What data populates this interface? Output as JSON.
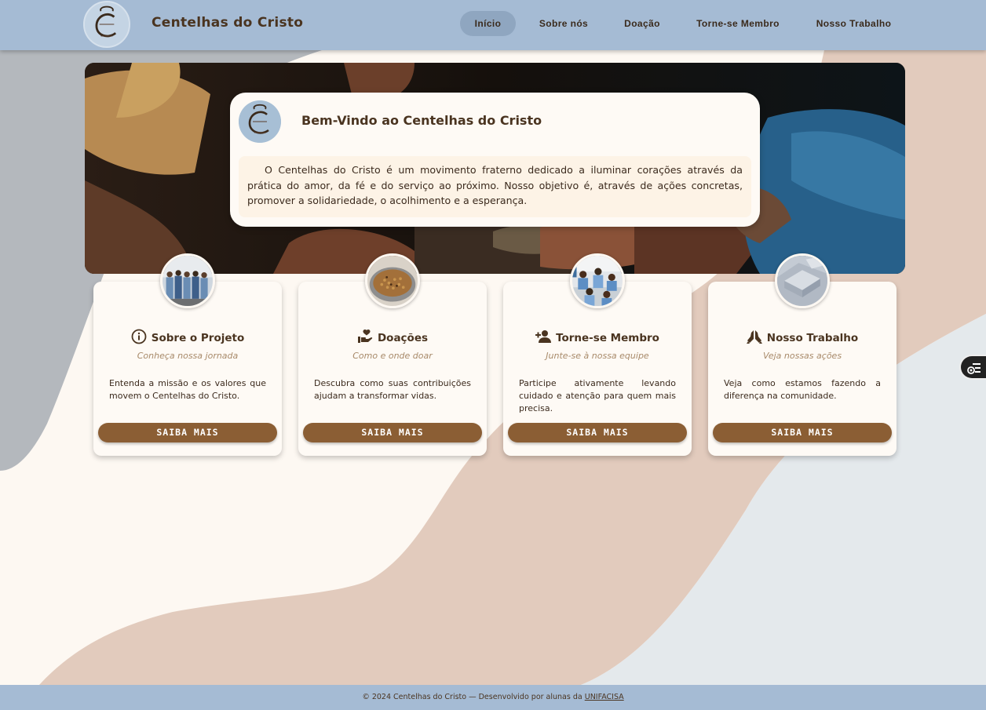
{
  "header": {
    "brand": "Centelhas do Cristo",
    "nav": [
      {
        "label": "Início",
        "active": true
      },
      {
        "label": "Sobre nós",
        "active": false
      },
      {
        "label": "Doação",
        "active": false
      },
      {
        "label": "Torne-se Membro",
        "active": false
      },
      {
        "label": "Nosso Trabalho",
        "active": false
      }
    ]
  },
  "welcome": {
    "title": "Bem-Vindo ao Centelhas do Cristo",
    "text": "O Centelhas do Cristo é um movimento fraterno dedicado a iluminar corações através da prática do amor, da fé e do serviço ao próximo. Nosso objetivo é, através de ações concretas, promover a solidariedade, o acolhimento e a esperança."
  },
  "cards": [
    {
      "icon": "info-icon",
      "title": "Sobre o Projeto",
      "subtitle": "Conheça nossa jornada",
      "description": "Entenda a missão e os valores que movem o Centelhas do Cristo.",
      "button": "SAIBA MAIS"
    },
    {
      "icon": "hand-heart-icon",
      "title": "Doações",
      "subtitle": "Como e onde doar",
      "description": "Descubra como suas contribuições ajudam a transformar vidas.",
      "button": "SAIBA MAIS"
    },
    {
      "icon": "user-plus-icon",
      "title": "Torne-se Membro",
      "subtitle": "Junte-se à nossa equipe",
      "description": "Participe ativamente levando cuidado e atenção para quem mais precisa.",
      "button": "SAIBA MAIS"
    },
    {
      "icon": "praying-hands-icon",
      "title": "Nosso Trabalho",
      "subtitle": "Veja nossas ações",
      "description": "Veja como estamos fazendo a diferença na comunidade.",
      "button": "SAIBA MAIS"
    }
  ],
  "footer": {
    "text": "© 2024 Centelhas do Cristo — Desenvolvido por alunas da ",
    "link": "UNIFACISA"
  },
  "colors": {
    "header_bg": "#a5bbd4",
    "nav_active_bg": "#8fa6c0",
    "accent_button": "#8b5e34",
    "text_brown": "#4a3420",
    "card_bg": "#fefaf5"
  }
}
